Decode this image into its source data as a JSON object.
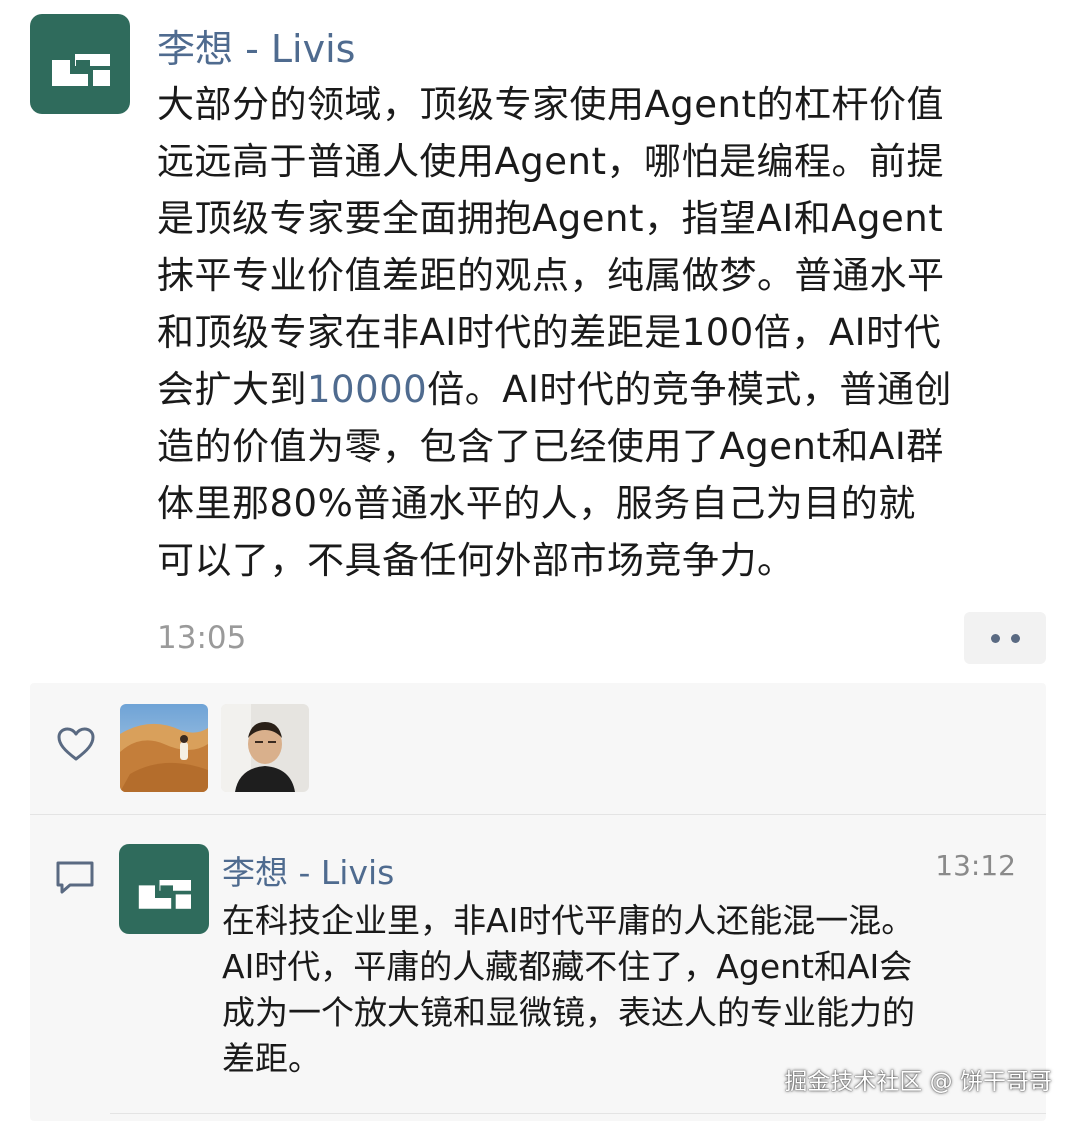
{
  "post": {
    "avatar": "brand-logo-dark-green",
    "author": "李想 - Livis",
    "body_before": "大部分的领域，顶级专家使用Agent的杠杆价值\n远远高于普通人使用Agent，哪怕是编程。前提\n是顶级专家要全面拥抱Agent，指望AI和Agent\n抹平专业价值差距的观点，纯属做梦。普通水平\n和顶级专家在非AI时代的差距是100倍，AI时代\n会扩大到",
    "body_highlight": "10000",
    "body_after": "倍。AI时代的竞争模式，普通创\n造的价值为零，包含了已经使用了Agent和AI群\n体里那80%普通水平的人，服务自己为目的就\n可以了，不具备任何外部市场竞争力。",
    "time": "13:05",
    "more_icon": "more-dots-icon"
  },
  "likes": {
    "icon": "heart-icon",
    "avatars": [
      "desert-photo-avatar",
      "man-portrait-avatar"
    ]
  },
  "comment": {
    "icon": "comment-icon",
    "author": "李想 - Livis",
    "time": "13:12",
    "text": "在科技企业里，非AI时代平庸的人还能混一混。\nAI时代，平庸的人藏都藏不住了，Agent和AI会\n成为一个放大镜和显微镜，表达人的专业能力的\n差距。"
  },
  "watermark": "掘金技术社区 @ 饼干哥哥",
  "colors": {
    "brand_green": "#2f6b5c",
    "name_blue": "#4f6b8f",
    "panel_bg": "#f7f7f7"
  }
}
